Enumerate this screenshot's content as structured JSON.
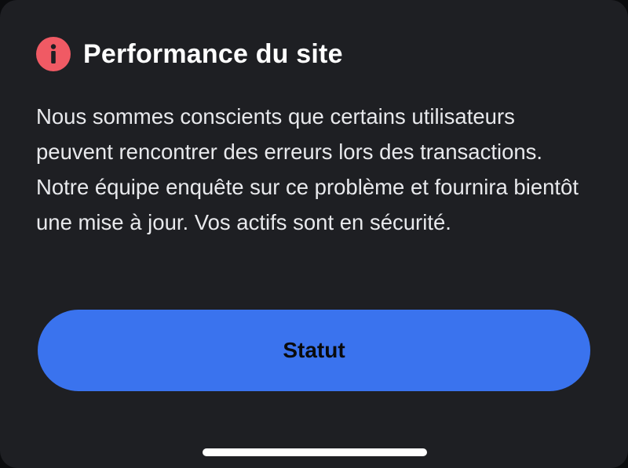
{
  "dialog": {
    "icon": "info-icon",
    "title": "Performance du site",
    "message": "Nous sommes conscients que certains utilisateurs peuvent rencontrer des erreurs lors des transactions. Notre équipe enquête sur ce problème et fournira bientôt une mise à jour. Vos actifs sont en sécurité.",
    "button_label": "Statut"
  },
  "colors": {
    "background": "#1e1f23",
    "icon_red": "#f05a64",
    "button_blue": "#3a73ee"
  }
}
